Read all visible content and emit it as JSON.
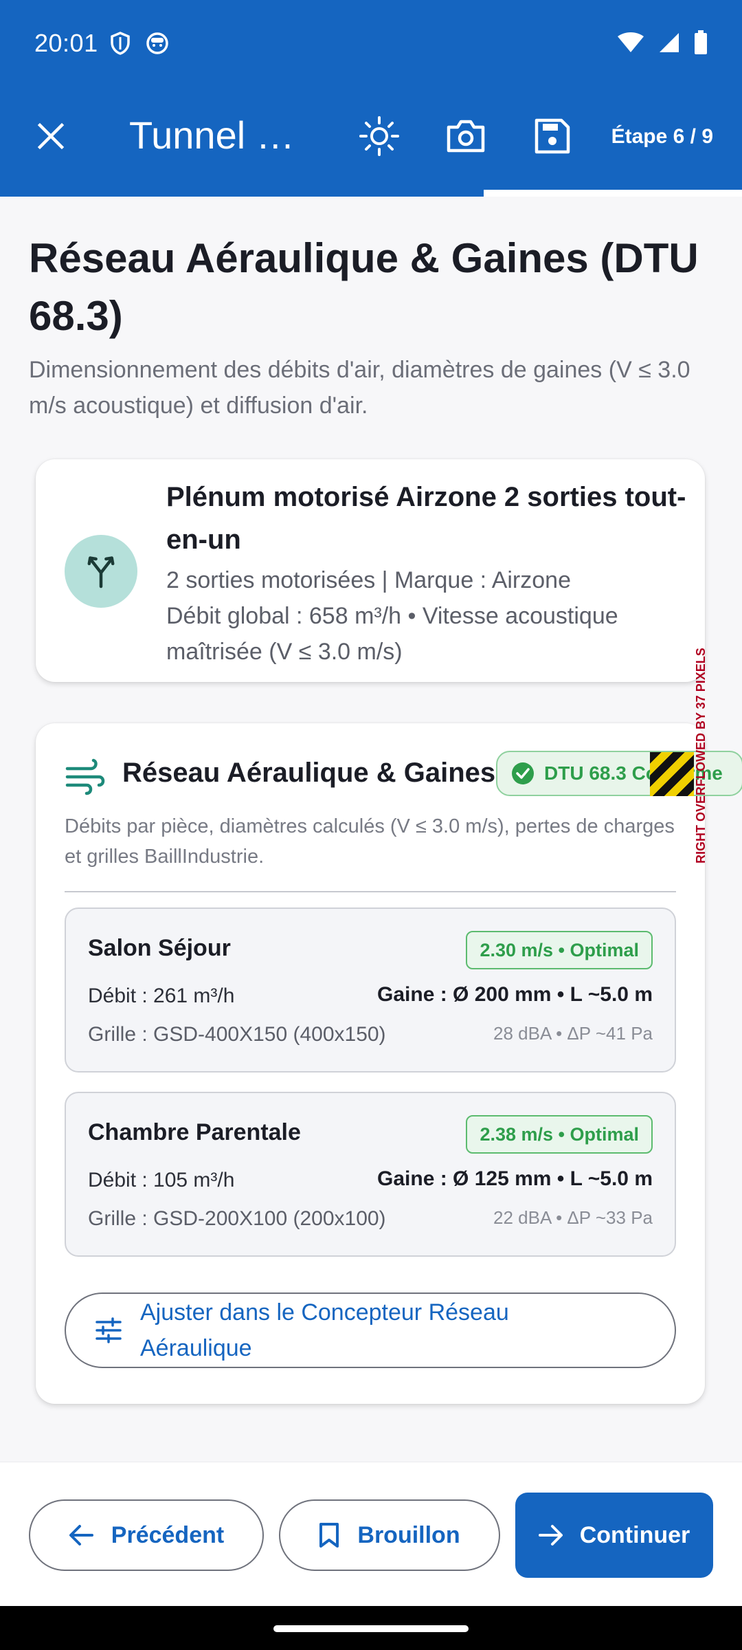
{
  "status_bar": {
    "time": "20:01"
  },
  "app_bar": {
    "title": "Tunnel d…",
    "step": "Étape 6 / 9",
    "progress_fraction": 0.6667
  },
  "page": {
    "title": "Réseau Aéraulique & Gaines (DTU 68.3)",
    "subtitle": "Dimensionnement des débits d'air, diamètres de gaines (V ≤ 3.0 m/s acoustique) et diffusion d'air."
  },
  "plenum": {
    "title": "Plénum motorisé Airzone 2 sorties tout-en-un",
    "line1": "2 sorties motorisées | Marque : Airzone",
    "line2": "Débit global : 658 m³/h • Vitesse acoustique maîtrisée (V ≤ 3.0 m/s)"
  },
  "network": {
    "title": "Réseau Aéraulique & Gaines",
    "badge": "DTU 68.3 Conforme",
    "overflow_warning": "RIGHT OVERFLOWED BY 37 PIXELS",
    "description": "Débits par pièce, diamètres calculés (V ≤ 3.0 m/s), pertes de charges et grilles BaillIndustrie.",
    "rooms": [
      {
        "name": "Salon Séjour",
        "badge": "2.30 m/s • Optimal",
        "debit": "Débit : 261 m³/h",
        "gaine": "Gaine : Ø 200 mm • L ~5.0 m",
        "grille": "Grille : GSD-400X150 (400x150)",
        "acoustic": "28 dBA • ΔP ~41 Pa"
      },
      {
        "name": "Chambre Parentale",
        "badge": "2.38 m/s • Optimal",
        "debit": "Débit : 105 m³/h",
        "gaine": "Gaine : Ø 125 mm • L ~5.0 m",
        "grille": "Grille : GSD-200X100 (200x100)",
        "acoustic": "22 dBA • ΔP ~33 Pa"
      }
    ],
    "adjust_button": "Ajuster dans le Concepteur Réseau Aéraulique"
  },
  "bottom_bar": {
    "previous": "Précédent",
    "draft": "Brouillon",
    "continue": "Continuer"
  },
  "colors": {
    "primary": "#1565C0",
    "success": "#2E9E4B",
    "teal_icon_bg": "#B5E0DA"
  }
}
